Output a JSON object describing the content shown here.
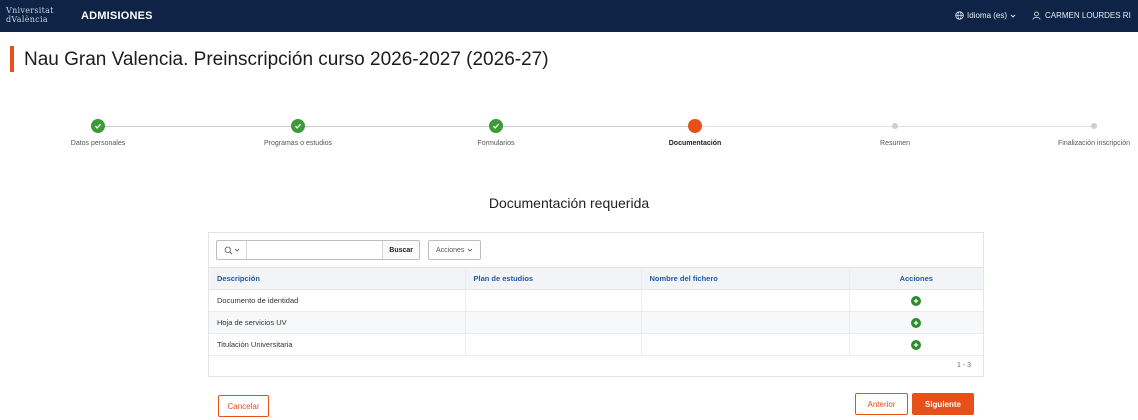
{
  "header": {
    "logo_line1": "Vniversitat",
    "logo_line2": "dValència",
    "app_name": "ADMISIONES",
    "language_label": "Idioma (es)",
    "user_name": "CARMEN LOURDES RI"
  },
  "page": {
    "title": "Nau Gran Valencia. Preinscripción curso 2026-2027 (2026-27)"
  },
  "stepper": {
    "steps": [
      {
        "label": "Datos personales",
        "state": "done"
      },
      {
        "label": "Programas o estudios",
        "state": "done"
      },
      {
        "label": "Formularios",
        "state": "done"
      },
      {
        "label": "Documentación",
        "state": "current"
      },
      {
        "label": "Resumen",
        "state": "todo"
      },
      {
        "label": "Finalización inscripción",
        "state": "todo"
      }
    ]
  },
  "section": {
    "heading": "Documentación requerida"
  },
  "toolbar": {
    "search_value": "",
    "search_button": "Buscar",
    "actions_menu": "Acciones"
  },
  "table": {
    "columns": [
      "Descripción",
      "Plan de estudios",
      "Nombre del fichero",
      "Acciones"
    ],
    "rows": [
      {
        "descripcion": "Documento de identidad",
        "plan": "",
        "fichero": ""
      },
      {
        "descripcion": "Hoja de servicios UV",
        "plan": "",
        "fichero": ""
      },
      {
        "descripcion": "Titulación Universitaria",
        "plan": "",
        "fichero": ""
      }
    ],
    "pagination": "1 - 3"
  },
  "buttons": {
    "cancel": "Cancelar",
    "previous": "Anterior",
    "next": "Siguiente"
  },
  "icons": {
    "globe": "globe-icon",
    "user": "user-icon",
    "search": "search-icon",
    "add": "add-icon",
    "check": "check-icon"
  },
  "colors": {
    "header_bg": "#0e2345",
    "accent": "#e8501a",
    "done": "#3d9a38",
    "link_blue": "#1f5aa8"
  }
}
